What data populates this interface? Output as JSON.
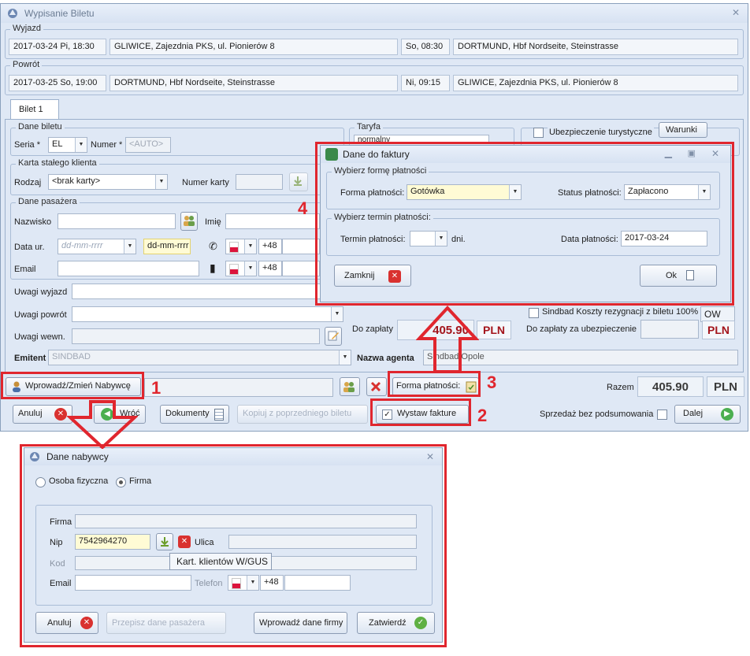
{
  "main_window": {
    "title": "Wypisanie Biletu",
    "close": "✕"
  },
  "wyjazd": {
    "legend": "Wyjazd",
    "date": "2017-03-24 Pi, 18:30",
    "from": "GLIWICE, Zajezdnia PKS, ul. Pionierów 8",
    "arr_time": "So, 08:30",
    "to": "DORTMUND, Hbf Nordseite, Steinstrasse"
  },
  "powrot": {
    "legend": "Powrót",
    "date": "2017-03-25 So, 19:00",
    "from": "DORTMUND, Hbf Nordseite, Steinstrasse",
    "arr_time": "Ni, 09:15",
    "to": "GLIWICE, Zajezdnia PKS, ul. Pionierów 8"
  },
  "tab": {
    "label": "Bilet 1"
  },
  "dane_biletu": {
    "legend": "Dane biletu",
    "seria_label": "Seria *",
    "seria_value": "EL",
    "numer_label": "Numer *",
    "numer_placeholder": "<AUTO>"
  },
  "taryfa": {
    "legend": "Taryfa",
    "value": "normalny"
  },
  "ubezpieczenie": {
    "label": "Ubezpieczenie turystyczne",
    "warunki": "Warunki"
  },
  "karta": {
    "legend": "Karta stałego klienta",
    "rodzaj_label": "Rodzaj",
    "rodzaj_value": "<brak karty>",
    "numer_label": "Numer karty"
  },
  "pasazer": {
    "legend": "Dane pasażera",
    "nazwisko_label": "Nazwisko",
    "imie_label": "Imię",
    "data_label": "Data ur.",
    "data_placeholder": "dd-mm-rrrr",
    "data_hint": "dd-mm-rrrr",
    "phone_prefix": "+48",
    "email_label": "Email",
    "mobile_prefix": "+48"
  },
  "uwagi": {
    "wyjazd": "Uwagi wyjazd",
    "powrot": "Uwagi powrót",
    "wewn": "Uwagi wewn."
  },
  "do_zaplaty": {
    "label": "Do zapłaty",
    "value": "405.90",
    "currency": "PLN"
  },
  "sindbad": {
    "label": "Sindbad Koszty rezygnacji z biletu 100%",
    "ow": "OW",
    "insurance_label": "Do zapłaty za ubezpieczenie",
    "currency": "PLN"
  },
  "emitent": {
    "label": "Emitent",
    "value": "SINDBAD",
    "agent_label": "Nazwa agenta",
    "agent_value": "Sindbad Opole"
  },
  "bottom": {
    "wprowadz": "Wprowadź/Zmień Nabywcę",
    "forma": "Forma płatności:",
    "razem_label": "Razem",
    "razem_value": "405.90",
    "razem_currency": "PLN",
    "anuluj": "Anuluj",
    "wroc": "Wróć",
    "dokumenty": "Dokumenty",
    "kopiuj": "Kopiuj z poprzedniego biletu",
    "wystaw": "Wystaw fakture",
    "sprzedaz": "Sprzedaż bez podsumowania",
    "dalej": "Dalej"
  },
  "faktura": {
    "title": "Dane do faktury",
    "group1": "Wybierz formę płatności",
    "forma_label": "Forma płatności:",
    "forma_value": "Gotówka",
    "status_label": "Status płatności:",
    "status_value": "Zapłacono",
    "group2": "Wybierz termin płatności:",
    "termin_label": "Termin płatności:",
    "dni": "dni.",
    "data_label": "Data płatności:",
    "data_value": "2017-03-24",
    "zamknij": "Zamknij",
    "ok": "Ok"
  },
  "nabywca": {
    "title": "Dane nabywcy",
    "osoba": "Osoba fizyczna",
    "firma": "Firma",
    "firma_label": "Firma",
    "nip_label": "Nip",
    "nip_value": "7542964270",
    "ulica_label": "Ulica",
    "kod_label": "Kod",
    "tooltip": "Kart. klientów W/GUS",
    "email_label": "Email",
    "telefon_label": "Telefon",
    "phone_prefix": "+48",
    "anuluj": "Anuluj",
    "przepisz": "Przepisz dane pasażera",
    "wprowadz": "Wprowadź dane firmy",
    "zatwierdz": "Zatwierdź"
  },
  "annotations": [
    "1",
    "2",
    "3",
    "4"
  ],
  "colors": {
    "accent_red": "#e0262e",
    "window_bg": "#dfe8f5",
    "pln_red": "#a3141b"
  }
}
